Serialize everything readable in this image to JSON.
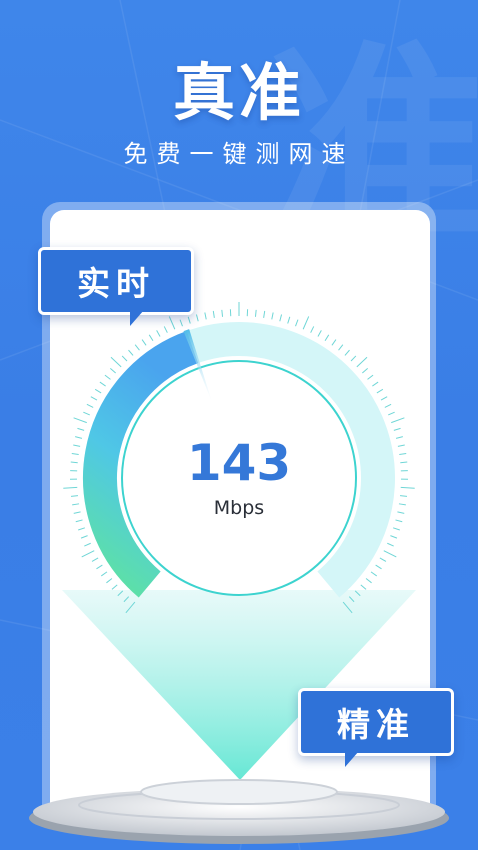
{
  "header": {
    "title": "真准",
    "subtitle": "免费一键测网速",
    "watermark": "准"
  },
  "gauge": {
    "speed_value": "143",
    "unit": "Mbps",
    "level_fraction": 0.43
  },
  "tags": {
    "realtime": "实时",
    "accurate": "精准"
  },
  "colors": {
    "background": "#3b80e8",
    "accent_blue": "#3578d8",
    "gauge_green": "#5fe3a0",
    "gauge_cyan": "#8fe7ee",
    "tag_blue": "#2f72d8"
  }
}
